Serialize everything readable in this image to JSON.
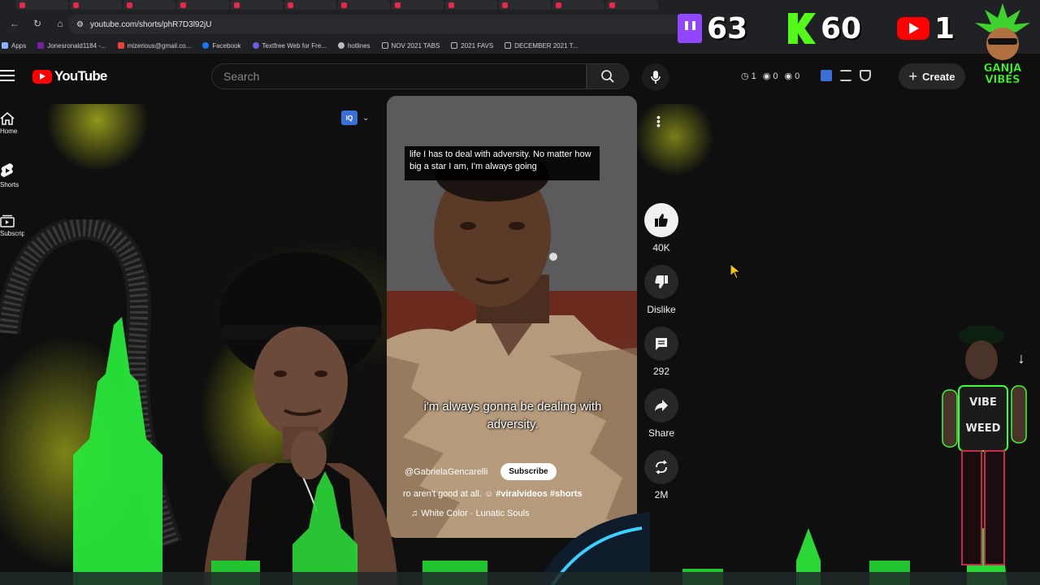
{
  "browser": {
    "url": "youtube.com/shorts/phR7D3l92jU",
    "bookmarks": [
      {
        "label": "Apps",
        "color": "#8ab4f8"
      },
      {
        "label": "Jonesronald1184 -...",
        "color": "#7a1fa2"
      },
      {
        "label": "mizerious@gmail.co...",
        "color": "#ea4335"
      },
      {
        "label": "Facebook",
        "color": "#1877f2"
      },
      {
        "label": "Textfree Web for Fre...",
        "color": "#6c5ce7"
      },
      {
        "label": "hotlines",
        "color": "#bbbbbb"
      },
      {
        "label": "NOV 2021 TABS",
        "color": "#bbbbbb"
      },
      {
        "label": "2021 FAVS",
        "color": "#bbbbbb"
      },
      {
        "label": "DECEMBER 2021 T...",
        "color": "#bbbbbb"
      }
    ]
  },
  "overlay": {
    "twitch_count": "63",
    "kick_count": "60",
    "youtube_count": "1",
    "brand_line1": "GANJA",
    "brand_line2": "VIBES"
  },
  "header": {
    "logo_text": "YouTube",
    "search_placeholder": "Search",
    "stat1": "1",
    "stat2": "0",
    "stat3": "0",
    "create_label": "Create"
  },
  "sidebar": {
    "items": [
      {
        "label": "Home",
        "icon": "home-icon"
      },
      {
        "label": "Shorts",
        "icon": "shorts-icon"
      },
      {
        "label": "Subscriptions",
        "icon": "subscriptions-icon"
      }
    ]
  },
  "video": {
    "caption_top": "life I has to deal with adversity. No matter how big a star I am, I'm always going",
    "caption_main": "i'm always gonna be dealing with adversity.",
    "channel": "@GabrielaGencarelli",
    "subscribe_label": "Subscribe",
    "description_prefix": "ro aren't good at all.",
    "hashtags": "#viralvideos #shorts",
    "music": "White Color · Lunatic Souls"
  },
  "actions": {
    "like_count": "40K",
    "dislike_label": "Dislike",
    "comments_count": "292",
    "share_label": "Share",
    "remix_count": "2M"
  },
  "colors": {
    "youtube_red": "#ff0000",
    "twitch_purple": "#9146ff",
    "kick_green": "#53fc18",
    "neon_yellow": "#e0e81a"
  }
}
